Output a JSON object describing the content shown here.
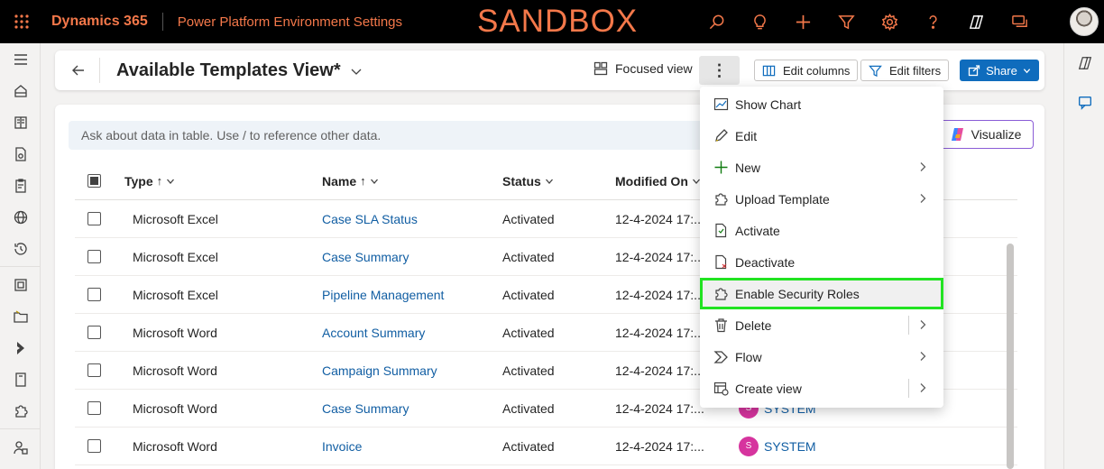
{
  "topbar": {
    "brand": "Dynamics 365",
    "environment": "Power Platform Environment Settings",
    "banner": "SANDBOX",
    "icons": [
      "search-icon",
      "lightbulb-icon",
      "plus-icon",
      "filter-icon",
      "gear-icon",
      "help-icon",
      "copilot-icon",
      "chat-icon"
    ]
  },
  "commandbar": {
    "title": "Available Templates View*",
    "focused_view": "Focused view",
    "more": "⋮",
    "edit_columns": "Edit columns",
    "edit_filters": "Edit filters",
    "share": "Share"
  },
  "ask": {
    "placeholder": "Ask about data in table. Use / to reference other data.",
    "visualize": "Visualize"
  },
  "grid": {
    "columns": {
      "type": "Type",
      "name": "Name",
      "status": "Status",
      "modified": "Modified On"
    },
    "sort_asc": "↑",
    "rows": [
      {
        "type": "Microsoft Excel",
        "name": "Case SLA Status",
        "status": "Activated",
        "modified": "12-4-2024 17:..."
      },
      {
        "type": "Microsoft Excel",
        "name": "Case Summary",
        "status": "Activated",
        "modified": "12-4-2024 17:..."
      },
      {
        "type": "Microsoft Excel",
        "name": "Pipeline Management",
        "status": "Activated",
        "modified": "12-4-2024 17:..."
      },
      {
        "type": "Microsoft Word",
        "name": "Account Summary",
        "status": "Activated",
        "modified": "12-4-2024 17:..."
      },
      {
        "type": "Microsoft Word",
        "name": "Campaign Summary",
        "status": "Activated",
        "modified": "12-4-2024 17:..."
      },
      {
        "type": "Microsoft Word",
        "name": "Case Summary",
        "status": "Activated",
        "modified": "12-4-2024 17:..."
      },
      {
        "type": "Microsoft Word",
        "name": "Invoice",
        "status": "Activated",
        "modified": "12-4-2024 17:..."
      }
    ],
    "owner_rows": [
      {
        "initial": "S",
        "name": "SYSTEM"
      },
      {
        "initial": "S",
        "name": "SYSTEM"
      }
    ]
  },
  "menu": {
    "items": [
      {
        "label": "Show Chart",
        "icon": "chart-icon"
      },
      {
        "label": "Edit",
        "icon": "pencil-icon"
      },
      {
        "label": "New",
        "icon": "plus-icon",
        "submenu": true
      },
      {
        "label": "Upload Template",
        "icon": "puzzle-icon",
        "submenu": true
      },
      {
        "label": "Activate",
        "icon": "document-check-icon"
      },
      {
        "label": "Deactivate",
        "icon": "document-x-icon"
      },
      {
        "label": "Enable Security Roles",
        "icon": "puzzle-icon",
        "highlighted": true
      },
      {
        "label": "Delete",
        "icon": "trash-icon",
        "split": true
      },
      {
        "label": "Flow",
        "icon": "flow-icon",
        "submenu": true
      },
      {
        "label": "Create view",
        "icon": "create-view-icon",
        "split": true
      }
    ]
  },
  "colors": {
    "brand_orange": "#f4784a",
    "link_blue": "#115ea3",
    "primary_blue": "#0f6cbd",
    "highlight_green": "#22e322",
    "avatar_pink": "#d6349e"
  }
}
